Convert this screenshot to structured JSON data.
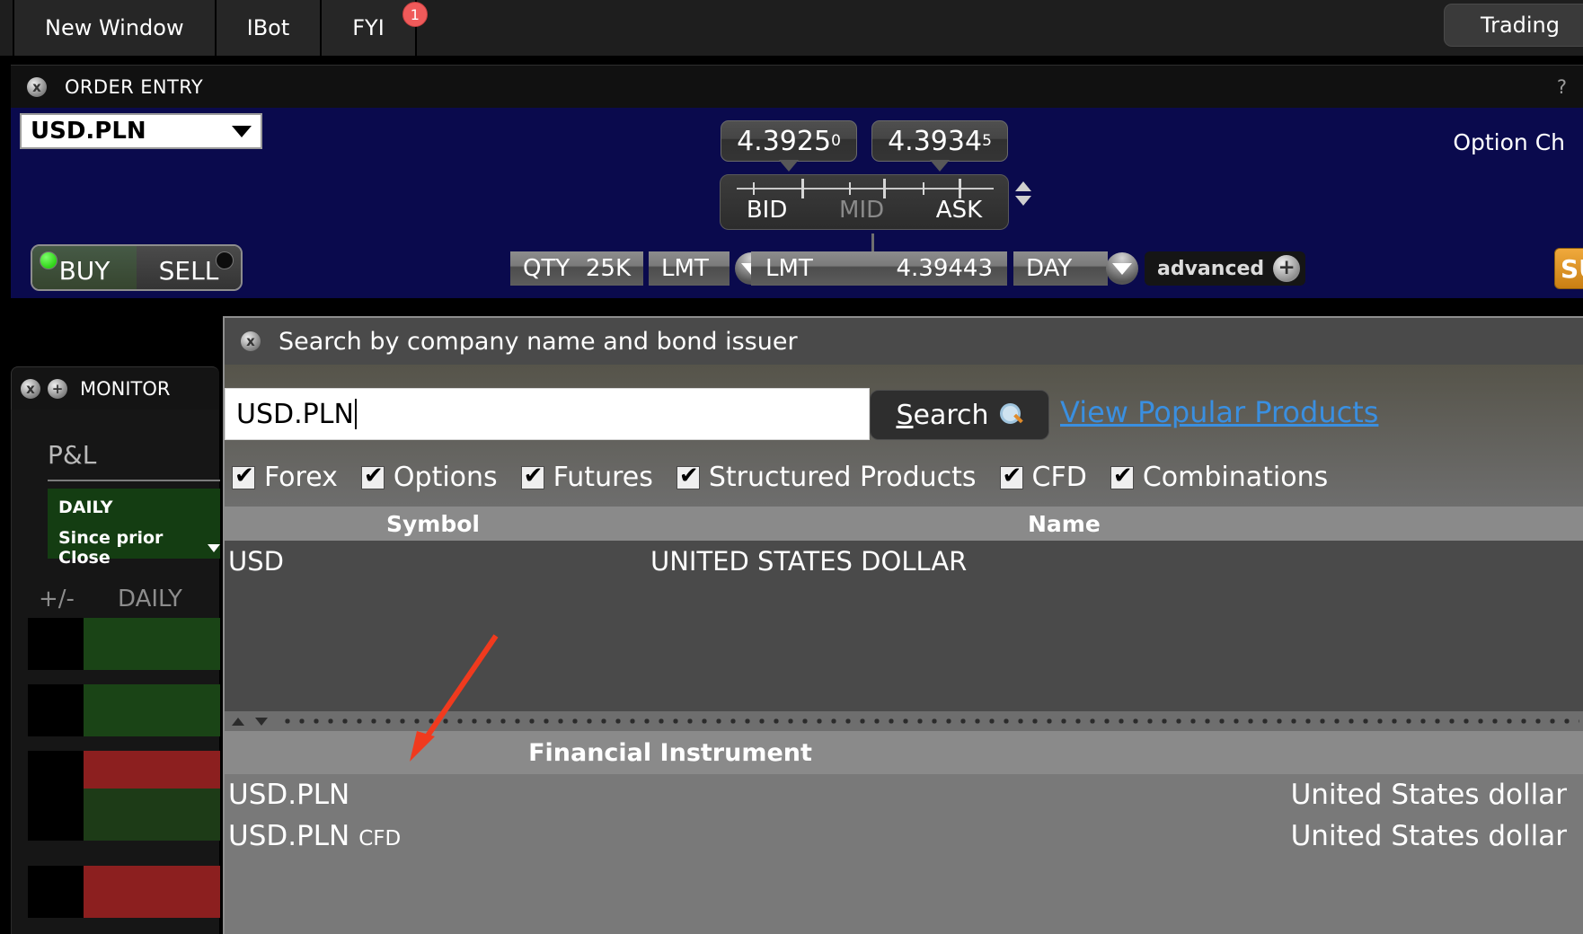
{
  "toolbar": {
    "buttons": [
      {
        "label": "New Window",
        "badge": null
      },
      {
        "label": "IBot",
        "badge": null
      },
      {
        "label": "FYI",
        "badge": "1"
      }
    ],
    "right_button": "Trading"
  },
  "order_entry": {
    "panel_title": "ORDER ENTRY",
    "help_icon": "?",
    "close_icon": "x",
    "symbol": "USD.PLN",
    "bid": {
      "price": "4.3925",
      "sup": "0"
    },
    "ask": {
      "price": "4.3934",
      "sup": "5"
    },
    "slider": {
      "bid": "BID",
      "mid": "MID",
      "ask": "ASK"
    },
    "option_chain_link": "Option Ch",
    "buy_label": "BUY",
    "sell_label": "SELL",
    "qty_label": "QTY",
    "qty_value": "25K",
    "order_type": "LMT",
    "order_type_field": "LMT",
    "limit_price": "4.39443",
    "tif": "DAY",
    "advanced": "advanced",
    "advanced_plus": "+",
    "submit_label": "SU"
  },
  "monitor": {
    "panel_title": "MONITOR",
    "close_icon": "x",
    "add_icon": "+",
    "pnl_label": "P&L",
    "daily_label": "DAILY",
    "since_label": "Since prior Close",
    "col_plusminus": "+/-",
    "col_daily": "DAILY",
    "rows": [
      {
        "accent": "#1a4416"
      },
      {
        "accent": "#1a4416"
      },
      {
        "accent": "#1a4416"
      },
      {
        "accent": "#8c1f1f"
      },
      {
        "accent": "#1d3b17"
      },
      {
        "accent": "#8c1f1f"
      }
    ]
  },
  "search_dialog": {
    "title": "Search by company name and bond issuer",
    "close_icon": "x",
    "query": "USD.PLN",
    "search_button": "Search",
    "search_button_mnemonic": "S",
    "search_icon": "magnifier-icon",
    "popular_link": "View Popular Products",
    "filters": [
      {
        "label": "Forex",
        "checked": true
      },
      {
        "label": "Options",
        "checked": true
      },
      {
        "label": "Futures",
        "checked": true
      },
      {
        "label": "Structured Products",
        "checked": true
      },
      {
        "label": "CFD",
        "checked": true
      },
      {
        "label": "Combinations",
        "checked": true
      }
    ],
    "results_columns": {
      "symbol": "Symbol",
      "name": "Name"
    },
    "results": [
      {
        "symbol": "USD",
        "name": "UNITED STATES DOLLAR"
      }
    ],
    "instruments_header": "Financial Instrument",
    "instruments": [
      {
        "symbol": "USD.PLN",
        "tag": "",
        "currency": "United States dollar"
      },
      {
        "symbol": "USD.PLN",
        "tag": "CFD",
        "currency": "United States dollar"
      }
    ]
  },
  "colors": {
    "accent_blue": "#0a0a4d",
    "link_blue": "#3a8fe0",
    "badge_red": "#ef5a5a",
    "annotation_red": "#f03a1e",
    "buy_green": "#2fd317"
  }
}
